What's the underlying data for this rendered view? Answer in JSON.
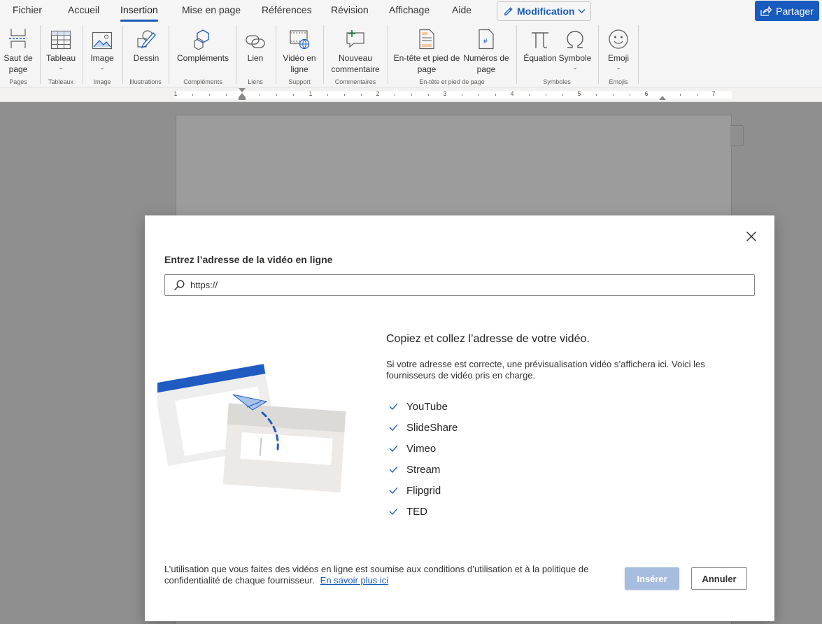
{
  "menubar": {
    "tabs": [
      "Fichier",
      "Accueil",
      "Insertion",
      "Mise en page",
      "Références",
      "Révision",
      "Affichage",
      "Aide"
    ],
    "active_tab": "Insertion",
    "mode_label": "Modification",
    "share_label": "Partager"
  },
  "ribbon": {
    "buttons": {
      "page_break": "Saut de page",
      "table": "Tableau",
      "image": "Image",
      "drawing": "Dessin",
      "addins": "Compléments",
      "link": "Lien",
      "online_video": "Vidéo en ligne",
      "new_comment": "Nouveau commentaire",
      "header_footer": "En-tête et pied de page",
      "page_numbers": "Numéros de page",
      "equation": "Équation",
      "symbol": "Symbole",
      "emoji": "Emoji"
    },
    "groups": {
      "pages": "Pages",
      "tables": "Tableaux",
      "image": "Image",
      "illustrations": "Illustrations",
      "addins": "Compléments",
      "links": "Liens",
      "media": "Support",
      "comments": "Commentaires",
      "header_footer": "En-tête et pied de page",
      "symbols": "Symboles",
      "emojis": "Emojis"
    }
  },
  "ruler": {
    "numbers": [
      "1",
      "1",
      "2",
      "3",
      "4",
      "5",
      "6",
      "7"
    ]
  },
  "dialog": {
    "title": "Entrez l’adresse de la vidéo en ligne",
    "url_value": "https://",
    "heading": "Copiez et collez l’adresse de votre vidéo.",
    "description": "Si votre adresse est correcte, une prévisualisation vidéo s’affichera ici. Voici les fournisseurs de vidéo pris en charge.",
    "providers": [
      "YouTube",
      "SlideShare",
      "Vimeo",
      "Stream",
      "Flipgrid",
      "TED"
    ],
    "footer_text": "L’utilisation que vous faites des vidéos en ligne est soumise aux conditions d’utilisation et à la politique de confidentialité de chaque fournisseur.",
    "footer_link": "En savoir plus ici",
    "insert_label": "Insérer",
    "cancel_label": "Annuler"
  },
  "icons": {
    "close": "close-icon",
    "search": "search-icon",
    "check": "check-icon",
    "pencil": "pencil-icon",
    "share": "share-icon"
  },
  "colors": {
    "accent": "#185abd",
    "insert_disabled": "#a7bde0",
    "illustration_blue": "#1f5bc1"
  }
}
